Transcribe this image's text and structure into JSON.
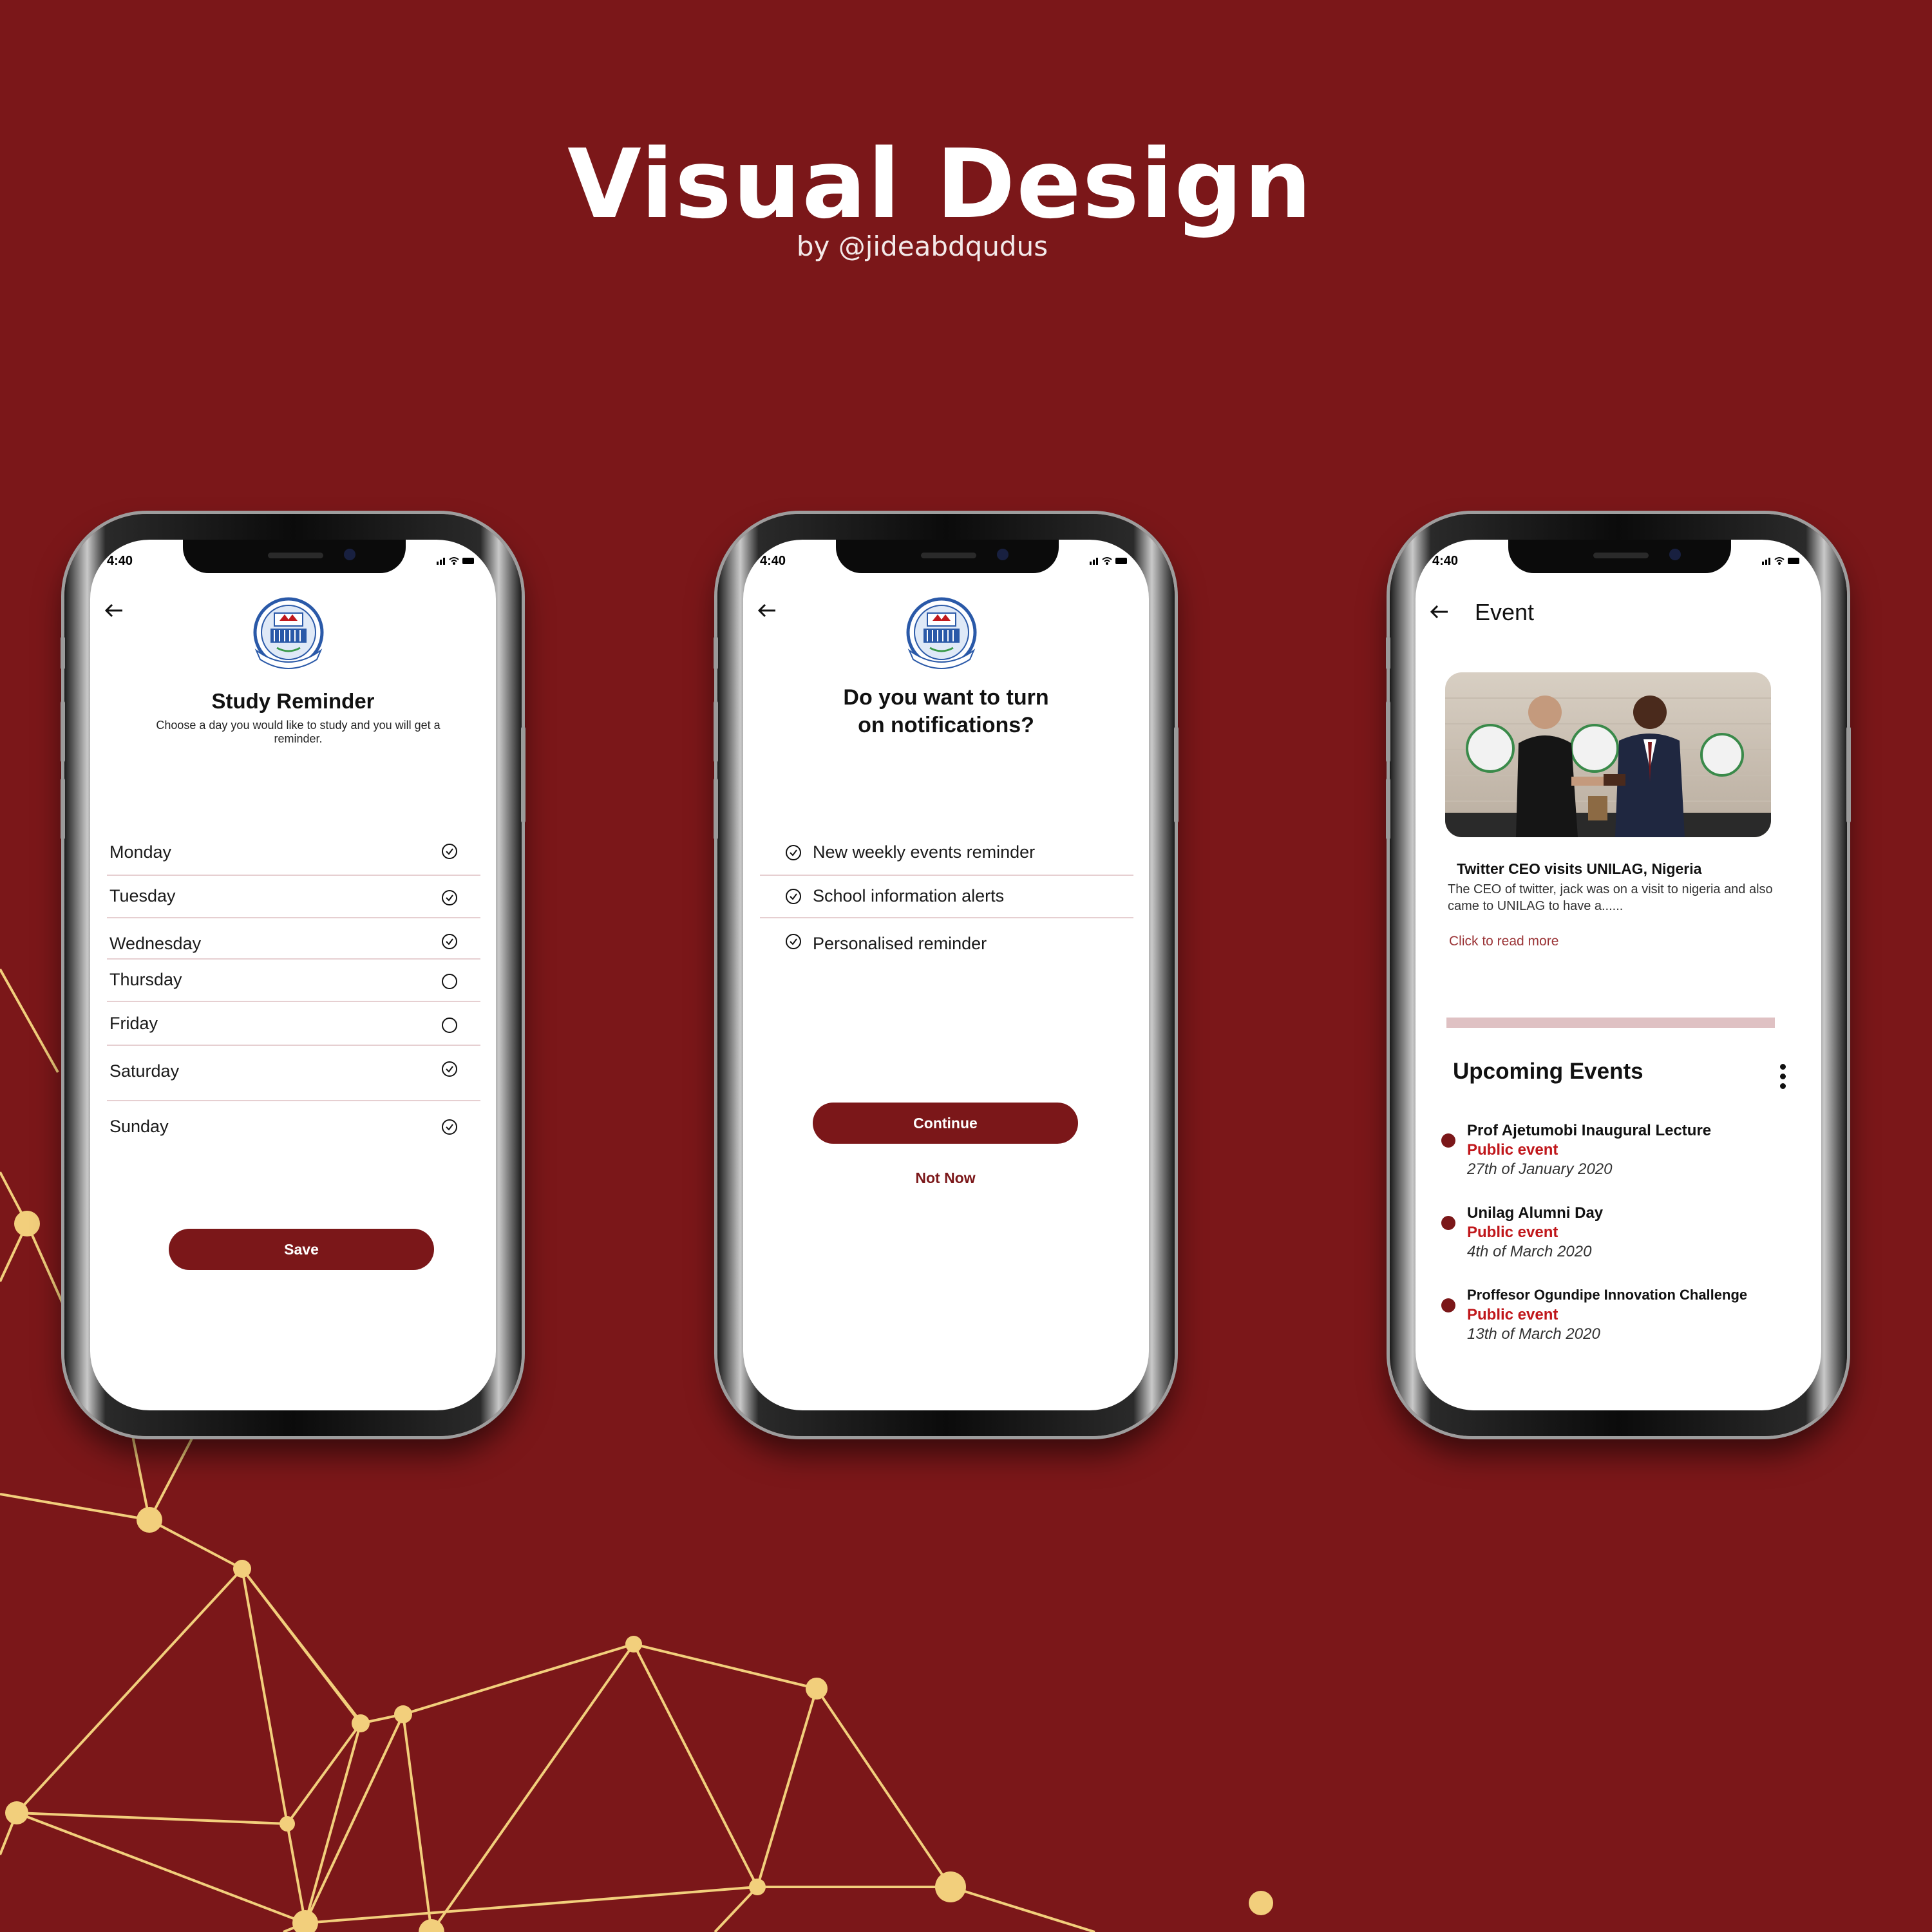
{
  "header": {
    "title": "Visual Design",
    "subtitle": "by @jideabdqudus"
  },
  "colors": {
    "background": "#7b1719",
    "accent": "#7b1719",
    "network": "#f2cf7c",
    "event_type": "#c0171b"
  },
  "status_bar": {
    "time": "4:40"
  },
  "study_reminder": {
    "title": "Study Reminder",
    "description": "Choose a day you would like to study and you will get a reminder.",
    "days": [
      {
        "label": "Monday",
        "checked": true
      },
      {
        "label": "Tuesday",
        "checked": true
      },
      {
        "label": "Wednesday",
        "checked": true
      },
      {
        "label": "Thursday",
        "checked": false
      },
      {
        "label": "Friday",
        "checked": false
      },
      {
        "label": "Saturday",
        "checked": true
      },
      {
        "label": "Sunday",
        "checked": true
      }
    ],
    "save_label": "Save"
  },
  "notifications": {
    "title_line1": "Do you want to turn",
    "title_line2": "on notifications?",
    "options": [
      {
        "label": "New weekly events reminder",
        "checked": true
      },
      {
        "label": "School information alerts",
        "checked": true
      },
      {
        "label": "Personalised reminder",
        "checked": true
      }
    ],
    "continue_label": "Continue",
    "not_now_label": "Not Now"
  },
  "event": {
    "title": "Event",
    "news": {
      "headline": "Twitter CEO visits UNILAG, Nigeria",
      "body": "The CEO of twitter, jack was on a visit to  nigeria and also came to UNILAG to have a......",
      "read_more": "Click to read more"
    },
    "upcoming_title": "Upcoming Events",
    "upcoming": [
      {
        "name": "Prof Ajetumobi Inaugural Lecture",
        "type": "Public event",
        "date": "27th of January 2020"
      },
      {
        "name": "Unilag Alumni Day",
        "type": "Public event",
        "date": "4th of March 2020"
      },
      {
        "name": "Proffesor Ogundipe Innovation Challenge",
        "type": "Public event",
        "date": "13th of March 2020"
      }
    ]
  }
}
